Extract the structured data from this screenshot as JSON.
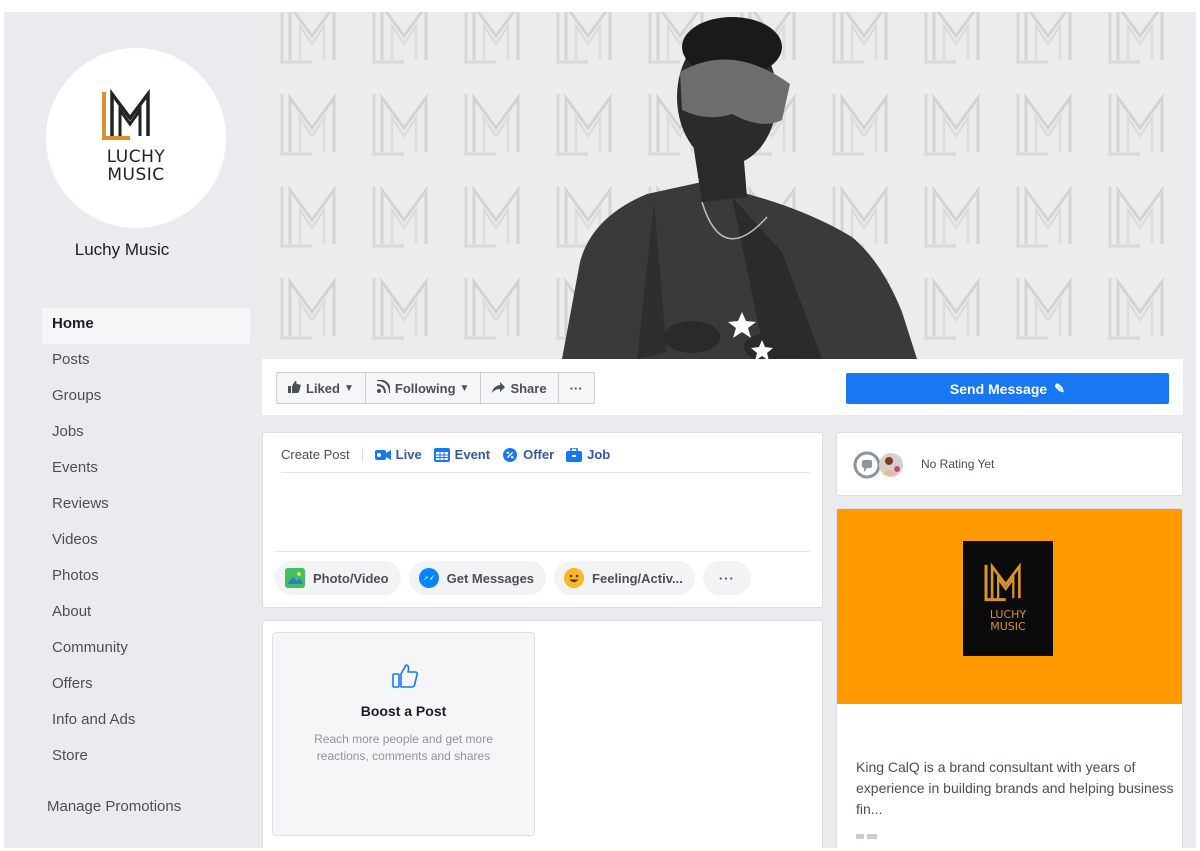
{
  "page": {
    "name": "Luchy Music",
    "logo_text_line1": "LUCHY",
    "logo_text_line2": "MUSIC"
  },
  "sidebar": {
    "items": [
      {
        "label": "Home",
        "active": true
      },
      {
        "label": "Posts"
      },
      {
        "label": "Groups"
      },
      {
        "label": "Jobs"
      },
      {
        "label": "Events"
      },
      {
        "label": "Reviews"
      },
      {
        "label": "Videos"
      },
      {
        "label": "Photos"
      },
      {
        "label": "About"
      },
      {
        "label": "Community"
      },
      {
        "label": "Offers"
      },
      {
        "label": "Info and Ads"
      },
      {
        "label": "Store"
      }
    ],
    "manage_promotions": "Manage Promotions"
  },
  "action_bar": {
    "liked": "Liked",
    "following": "Following",
    "share": "Share",
    "more": "···",
    "send_message": "Send Message"
  },
  "create_post": {
    "tabs": {
      "create_post": "Create Post",
      "live": "Live",
      "event": "Event",
      "offer": "Offer",
      "job": "Job"
    },
    "actions": {
      "photo_video": "Photo/Video",
      "get_messages": "Get Messages",
      "feeling": "Feeling/Activ...",
      "more": "···"
    }
  },
  "boost": {
    "title": "Boost a Post",
    "description": "Reach more people and get more reactions, comments and shares"
  },
  "rating": {
    "text": "No Rating Yet"
  },
  "about": {
    "description": "King CalQ is a brand consultant with years of experience in building brands and helping business fin..."
  },
  "colors": {
    "brand_blue": "#1877f2",
    "link_blue": "#365899",
    "about_orange": "#ff9a00",
    "logo_gold": "#d9932b"
  },
  "icons": {
    "liked": "thumbs-up-icon",
    "following": "rss-icon",
    "share": "share-arrow-icon",
    "send_message": "pencil-icon",
    "live": "video-camera-icon",
    "event": "calendar-icon",
    "offer": "percent-tag-icon",
    "job": "briefcase-icon",
    "photo_video": "photo-icon",
    "get_messages": "messenger-icon",
    "feeling": "smiley-icon",
    "boost": "thumbs-up-outline-icon"
  }
}
